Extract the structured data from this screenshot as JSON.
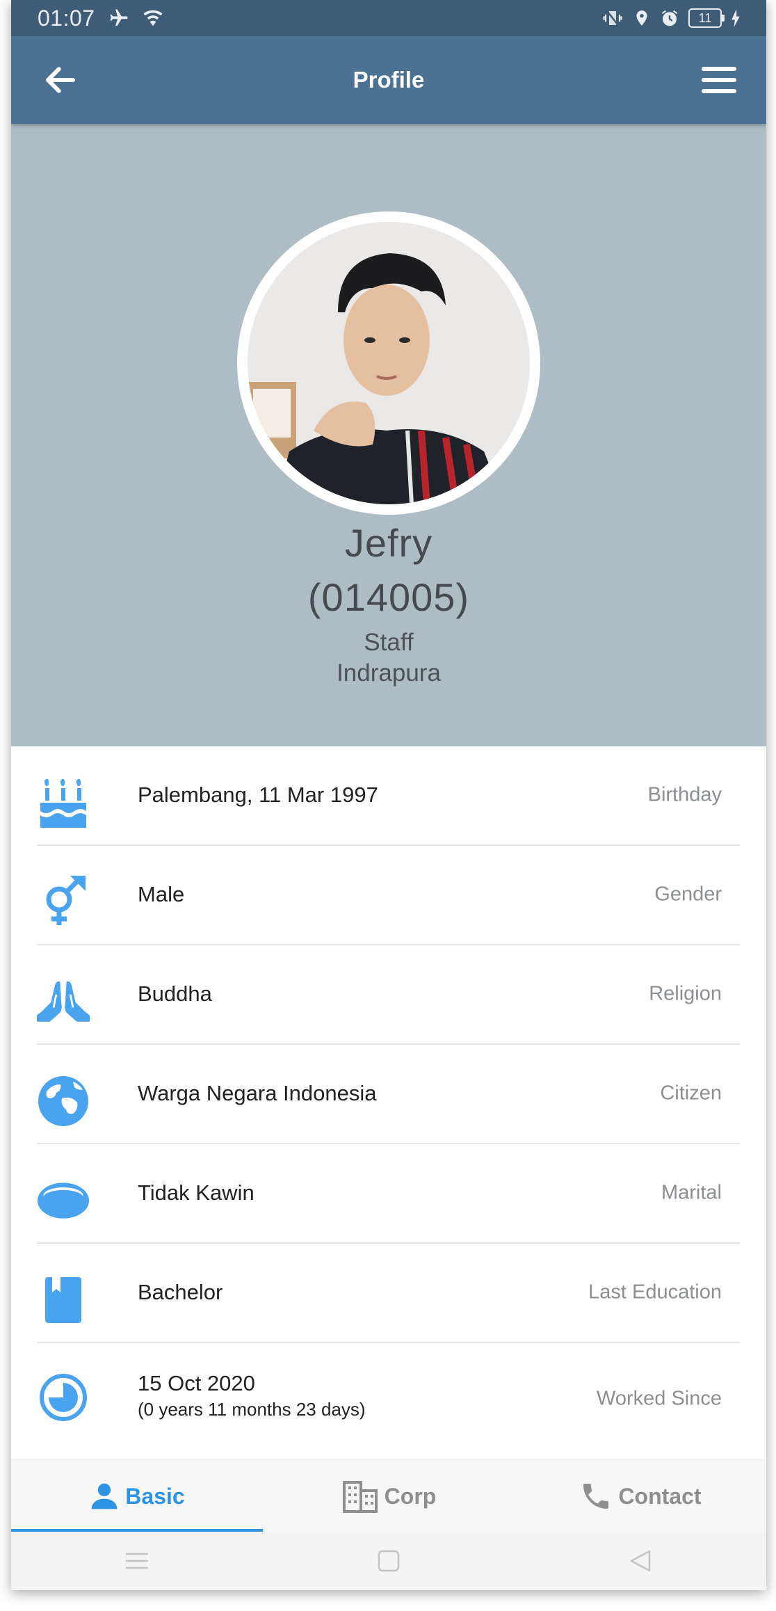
{
  "status_bar": {
    "time": "01:07",
    "battery": "11",
    "icons": [
      "airplane-icon",
      "wifi-icon",
      "vibrate-icon",
      "location-icon",
      "alarm-icon",
      "battery-icon",
      "charging-icon"
    ]
  },
  "app_bar": {
    "title": "Profile",
    "back_icon": "back-arrow-icon",
    "menu_icon": "hamburger-menu-icon"
  },
  "profile": {
    "name": "Jefry",
    "id": "(014005)",
    "role": "Staff",
    "location": "Indrapura"
  },
  "info": [
    {
      "icon": "birthday-cake-icon",
      "value": "Palembang, 11 Mar 1997",
      "label": "Birthday"
    },
    {
      "icon": "gender-icon",
      "value": "Male",
      "label": "Gender"
    },
    {
      "icon": "praying-hands-icon",
      "value": "Buddha",
      "label": "Religion"
    },
    {
      "icon": "globe-icon",
      "value": "Warga Negara Indonesia",
      "label": "Citizen"
    },
    {
      "icon": "ring-icon",
      "value": "Tidak Kawin",
      "label": "Marital"
    },
    {
      "icon": "book-icon",
      "value": "Bachelor",
      "label": "Last Education"
    },
    {
      "icon": "clock-icon",
      "value": "15 Oct 2020",
      "subvalue": "(0 years 11 months 23 days)",
      "label": "Worked Since"
    }
  ],
  "bottom_nav": [
    {
      "label": "Basic",
      "icon": "person-icon",
      "active": true
    },
    {
      "label": "Corp",
      "icon": "building-icon",
      "active": false
    },
    {
      "label": "Contact",
      "icon": "phone-icon",
      "active": false
    }
  ],
  "colors": {
    "app_bar": "#4b7193",
    "status_bar": "#3f5c76",
    "header_bg": "#aebdc5",
    "accent": "#2e93e4",
    "icon_blue": "#4aa3ef"
  }
}
